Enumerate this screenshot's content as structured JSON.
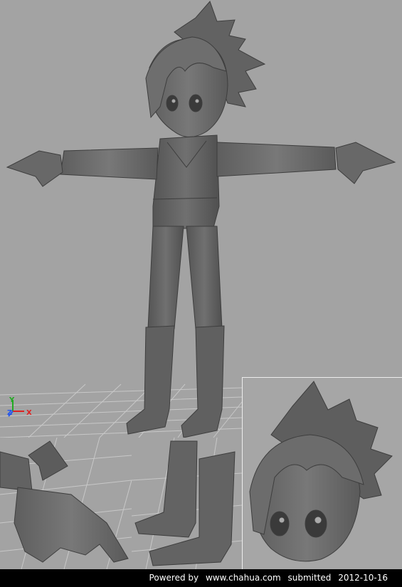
{
  "viewport": {
    "background": "#a3a3a3",
    "model_color": "#6a6a6a",
    "grid_color": "#c4c4c4"
  },
  "axis_gizmo": {
    "y_label": "Y",
    "z_label": "Z",
    "x_label": "X",
    "colors": {
      "y": "#22aa22",
      "z": "#2255ee",
      "x": "#dd2222"
    }
  },
  "footer": {
    "powered_by": "Powered by",
    "site": "www.chahua.com",
    "submitted_label": "submitted",
    "date": "2012-10-16"
  }
}
